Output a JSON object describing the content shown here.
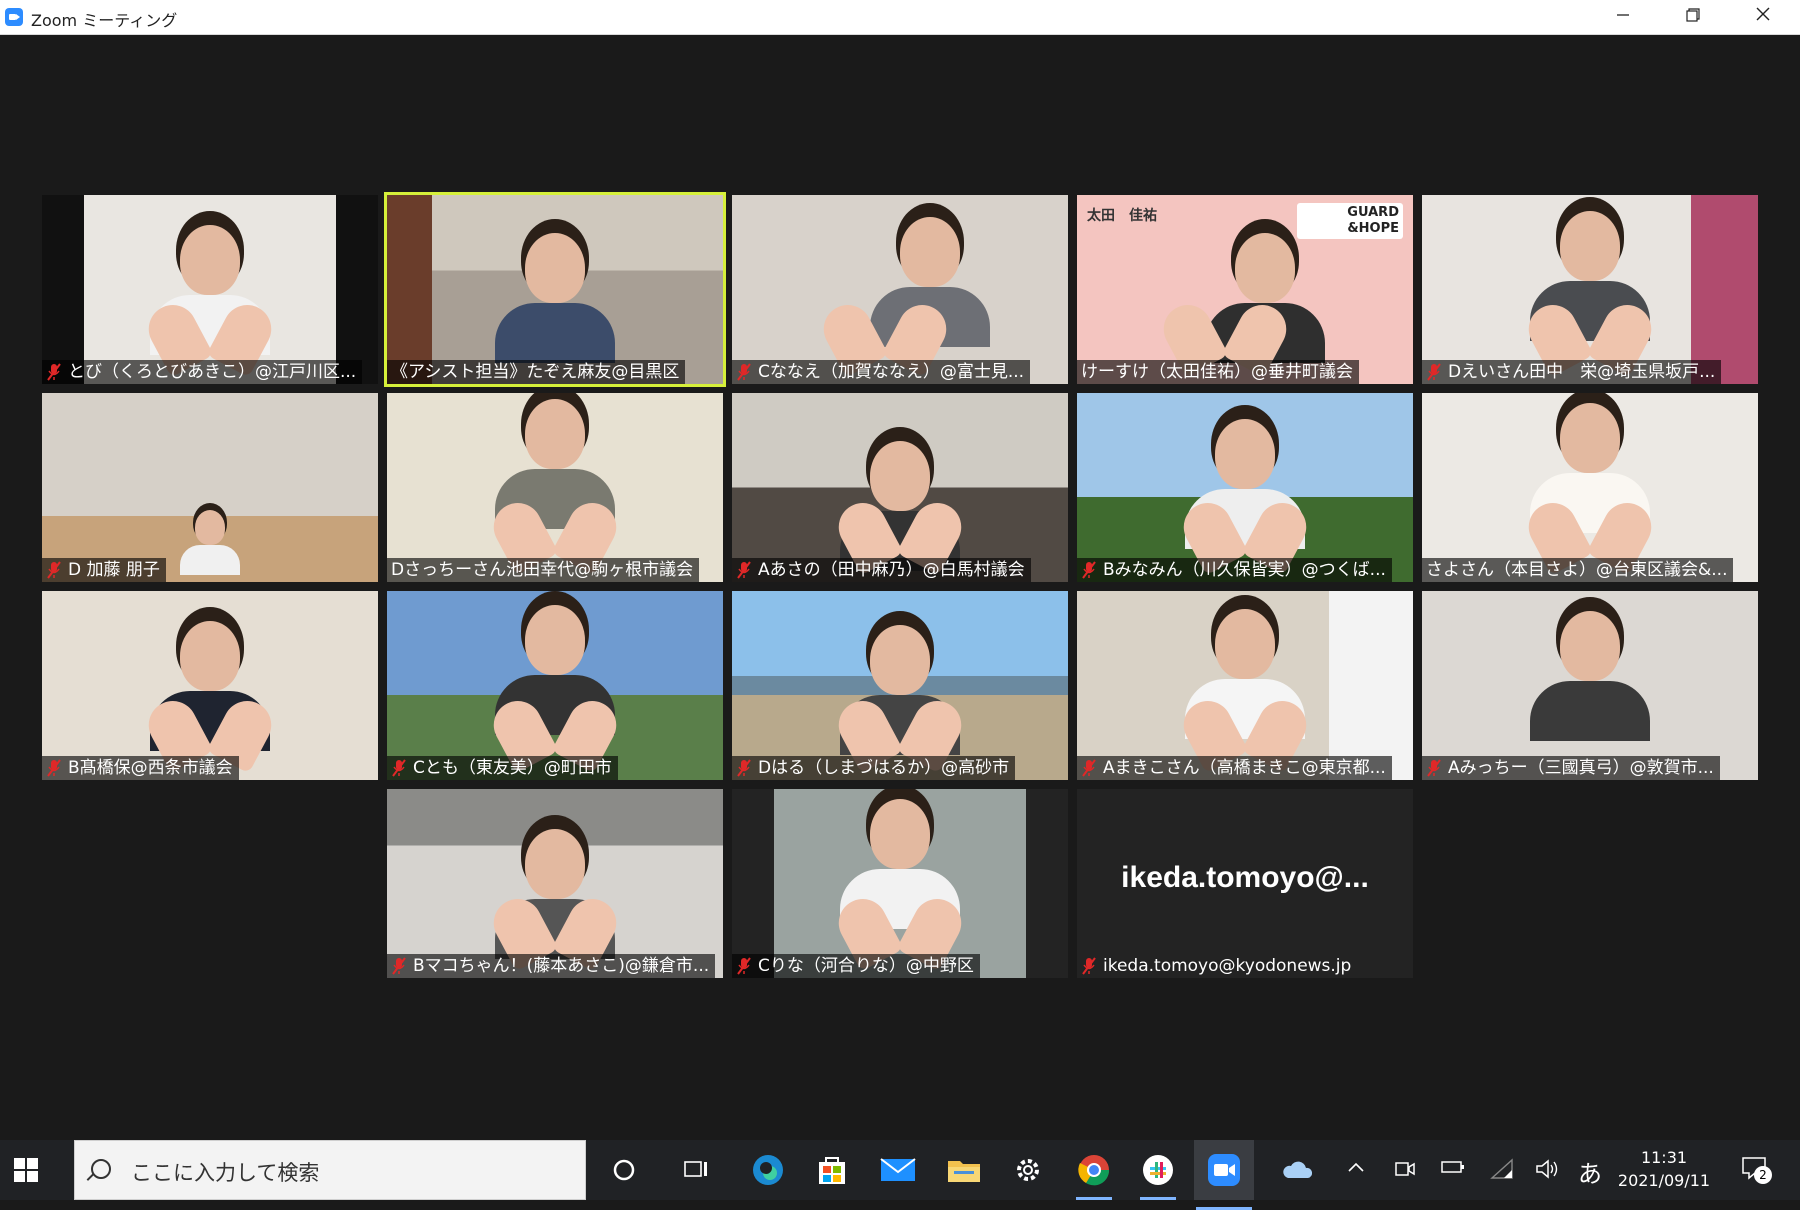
{
  "window": {
    "title": "Zoom ミーティング",
    "controls": [
      "minimize",
      "maximize",
      "close"
    ]
  },
  "participants": [
    {
      "name": "とび（くろとびあきこ）@江戸川区...",
      "muted": true
    },
    {
      "name": "《アシスト担当》たぞえ麻友@目黒区",
      "muted": false,
      "speaking": true
    },
    {
      "name": "Cななえ（加賀ななえ）@富士見...",
      "muted": true
    },
    {
      "name": "けーすけ（太田佳祐）@垂井町議会",
      "muted": false
    },
    {
      "name": "Dえいさん田中　栄@埼玉県坂戸...",
      "muted": true
    },
    {
      "name": "D 加藤 朋子",
      "muted": true
    },
    {
      "name": "Dさっちーさん池田幸代@駒ヶ根市議会",
      "muted": false
    },
    {
      "name": "Aあさの（田中麻乃）@白馬村議会",
      "muted": true
    },
    {
      "name": "Bみなみん（川久保皆実）@つくば...",
      "muted": true
    },
    {
      "name": "さよさん（本目さよ）@台東区議会&...",
      "muted": false
    },
    {
      "name": "B髙橋保@西条市議会",
      "muted": true
    },
    {
      "name": "Cとも（東友美）@町田市",
      "muted": true
    },
    {
      "name": "Dはる（しまづはるか）@高砂市",
      "muted": true
    },
    {
      "name": "Aまきこさん（高橋まきこ@東京都...",
      "muted": true
    },
    {
      "name": "Aみっちー（三國真弓）@敦賀市...",
      "muted": true
    },
    {
      "name": "Bマコちゃん！(藤本あさこ)@鎌倉市...",
      "muted": true
    },
    {
      "name": "Cりな（河合りな）@中野区",
      "muted": true
    },
    {
      "name": "ikeda.tomoyo@kyodonews.jp",
      "muted": true,
      "video_off": true,
      "display": "ikeda.tomoyo@..."
    }
  ],
  "poster": {
    "org": "GUARD &HOPE",
    "person": "太田　佳祐"
  },
  "taskbar": {
    "search_placeholder": "ここに入力して検索",
    "ime": "あ",
    "time": "11:31",
    "date": "2021/09/11",
    "notifications": "2"
  }
}
